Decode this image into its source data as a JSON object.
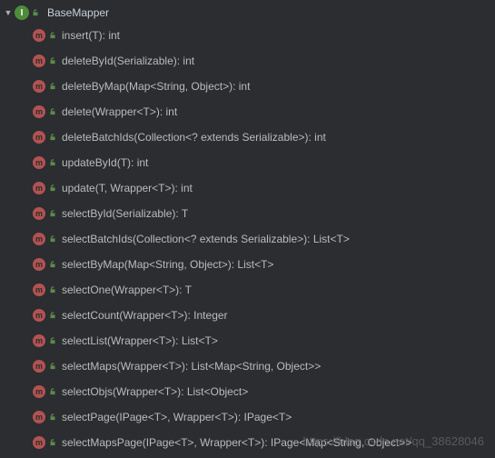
{
  "root": {
    "name": "BaseMapper"
  },
  "methods": [
    {
      "signature": "insert(T): int"
    },
    {
      "signature": "deleteById(Serializable): int"
    },
    {
      "signature": "deleteByMap(Map<String, Object>): int"
    },
    {
      "signature": "delete(Wrapper<T>): int"
    },
    {
      "signature": "deleteBatchIds(Collection<? extends Serializable>): int"
    },
    {
      "signature": "updateById(T): int"
    },
    {
      "signature": "update(T, Wrapper<T>): int"
    },
    {
      "signature": "selectById(Serializable): T"
    },
    {
      "signature": "selectBatchIds(Collection<? extends Serializable>): List<T>"
    },
    {
      "signature": "selectByMap(Map<String, Object>): List<T>"
    },
    {
      "signature": "selectOne(Wrapper<T>): T"
    },
    {
      "signature": "selectCount(Wrapper<T>): Integer"
    },
    {
      "signature": "selectList(Wrapper<T>): List<T>"
    },
    {
      "signature": "selectMaps(Wrapper<T>): List<Map<String, Object>>"
    },
    {
      "signature": "selectObjs(Wrapper<T>): List<Object>"
    },
    {
      "signature": "selectPage(IPage<T>, Wrapper<T>): IPage<T>"
    },
    {
      "signature": "selectMapsPage(IPage<T>, Wrapper<T>): IPage<Map<String, Object>>"
    }
  ],
  "watermark": "https://blog.csdn.net/qq_38628046"
}
